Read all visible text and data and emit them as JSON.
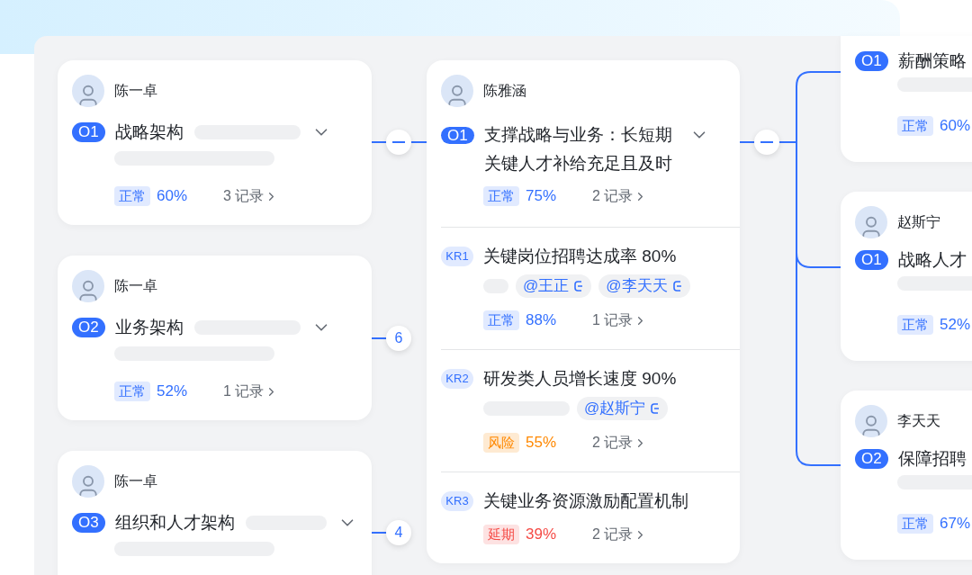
{
  "left_objectives": [
    {
      "owner": "陈一卓",
      "code": "O1",
      "title": "战略架构",
      "status": {
        "kind": "normal",
        "label": "正常"
      },
      "progress": "60%",
      "records": "3 记录",
      "expanded": true
    },
    {
      "owner": "陈一卓",
      "code": "O2",
      "title": "业务架构",
      "status": {
        "kind": "normal",
        "label": "正常"
      },
      "progress": "52%",
      "records": "1 记录",
      "expanded": false,
      "count": "6"
    },
    {
      "owner": "陈一卓",
      "code": "O3",
      "title": "组织和人才架构",
      "expanded": false,
      "count": "4"
    }
  ],
  "center": {
    "owner": "陈雅涵",
    "code": "O1",
    "title": "支撑战略与业务：长短期关键人才补给充足且及时",
    "status": {
      "kind": "normal",
      "label": "正常"
    },
    "progress": "75%",
    "records": "2 记录",
    "expanded": true,
    "key_results": [
      {
        "code": "KR1",
        "title": "关键岗位招聘达成率 80%",
        "mentions": [
          "@王正",
          "@李天天"
        ],
        "status": {
          "kind": "normal",
          "label": "正常"
        },
        "progress": "88%",
        "records": "1 记录"
      },
      {
        "code": "KR2",
        "title": "研发类人员增长速度 90%",
        "mentions": [
          "@赵斯宁"
        ],
        "status": {
          "kind": "risk",
          "label": "风险"
        },
        "progress": "55%",
        "records": "2 记录"
      },
      {
        "code": "KR3",
        "title": "关键业务资源激励配置机制",
        "status": {
          "kind": "delayed",
          "label": "延期"
        },
        "progress": "39%",
        "records": "2 记录"
      }
    ]
  },
  "right_objectives": [
    {
      "code": "O1",
      "title": "薪酬策略",
      "status": {
        "kind": "normal",
        "label": "正常"
      },
      "progress": "60%"
    },
    {
      "owner": "赵斯宁",
      "code": "O1",
      "title": "战略人才",
      "status": {
        "kind": "normal",
        "label": "正常"
      },
      "progress": "52%"
    },
    {
      "owner": "李天天",
      "code": "O2",
      "title": "保障招聘",
      "status": {
        "kind": "normal",
        "label": "正常"
      },
      "progress": "67%"
    }
  ]
}
